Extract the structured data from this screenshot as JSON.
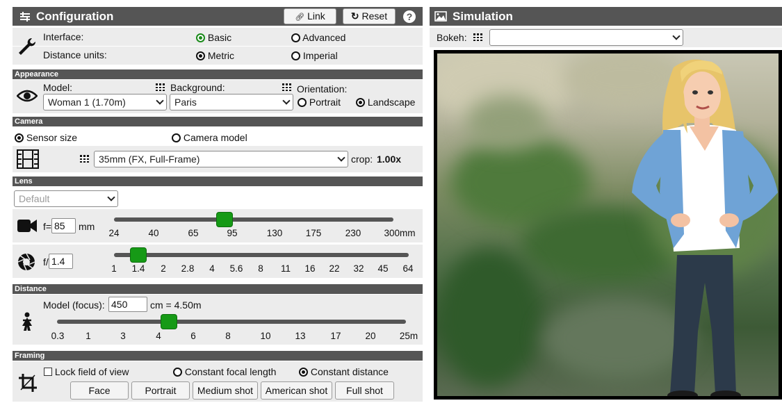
{
  "config": {
    "title": "Configuration",
    "link_label": "Link",
    "reset_label": "Reset",
    "help_symbol": "?",
    "interface_label": "Interface:",
    "interface_options": [
      "Basic",
      "Advanced"
    ],
    "interface_selected": "Basic",
    "units_label": "Distance units:",
    "units_options": [
      "Metric",
      "Imperial"
    ],
    "units_selected": "Metric"
  },
  "appearance": {
    "section": "Appearance",
    "model_label": "Model:",
    "model_value": "Woman 1 (1.70m)",
    "background_label": "Background:",
    "background_value": "Paris",
    "orientation_label": "Orientation:",
    "orientation_options": [
      "Portrait",
      "Landscape"
    ],
    "orientation_selected": "Landscape"
  },
  "camera": {
    "section": "Camera",
    "mode_options": [
      "Sensor size",
      "Camera model"
    ],
    "mode_selected": "Sensor size",
    "sensor_value": "35mm (FX, Full-Frame)",
    "crop_label": "crop:",
    "crop_value": "1.00x"
  },
  "lens": {
    "section": "Lens",
    "preset_value": "Default",
    "focal_prefix": "f=",
    "focal_value": "85",
    "focal_unit": "mm",
    "focal_ticks": [
      "24",
      "40",
      "65",
      "95",
      "130",
      "175",
      "230",
      "300mm"
    ],
    "aperture_prefix": "f/",
    "aperture_value": "1.4",
    "aperture_ticks": [
      "1",
      "1.4",
      "2",
      "2.8",
      "4",
      "5.6",
      "8",
      "11",
      "16",
      "22",
      "32",
      "45",
      "64"
    ]
  },
  "distance": {
    "section": "Distance",
    "label": "Model (focus):",
    "value": "450",
    "converted": "cm = 4.50m",
    "ticks": [
      "0.3",
      "1",
      "3",
      "4",
      "6",
      "8",
      "10",
      "13",
      "17",
      "20",
      "25m"
    ]
  },
  "framing": {
    "section": "Framing",
    "lock_label": "Lock field of view",
    "mode_options": [
      "Constant focal length",
      "Constant distance"
    ],
    "mode_selected": "Constant distance",
    "buttons": [
      "Face",
      "Portrait",
      "Medium shot",
      "American shot",
      "Full shot"
    ]
  },
  "simulation": {
    "title": "Simulation",
    "bokeh_label": "Bokeh:",
    "bokeh_value": ""
  }
}
